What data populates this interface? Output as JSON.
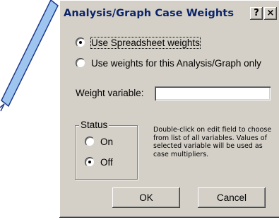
{
  "dialog": {
    "title": "Analysis/Graph Case Weights",
    "help_button": "?",
    "close_button": "×"
  },
  "weights_source": {
    "option_spreadsheet": "Use Spreadsheet weights",
    "option_analysis": "Use weights for this Analysis/Graph only",
    "selected": "option_spreadsheet"
  },
  "weight_variable": {
    "label": "Weight variable:",
    "value": ""
  },
  "status": {
    "legend": "Status",
    "on_label": "On",
    "off_label": "Off",
    "selected": "off"
  },
  "help_text": "Double-click on edit field to choose from list of all variables. Values of selected variable will be used as case multipliers.",
  "buttons": {
    "ok": "OK",
    "cancel": "Cancel"
  },
  "colors": {
    "dialog_face": "#d4d0c8",
    "title_text": "#0a246a",
    "arrow_fill": "#9ec5f0",
    "arrow_stroke": "#1f3a8a"
  }
}
